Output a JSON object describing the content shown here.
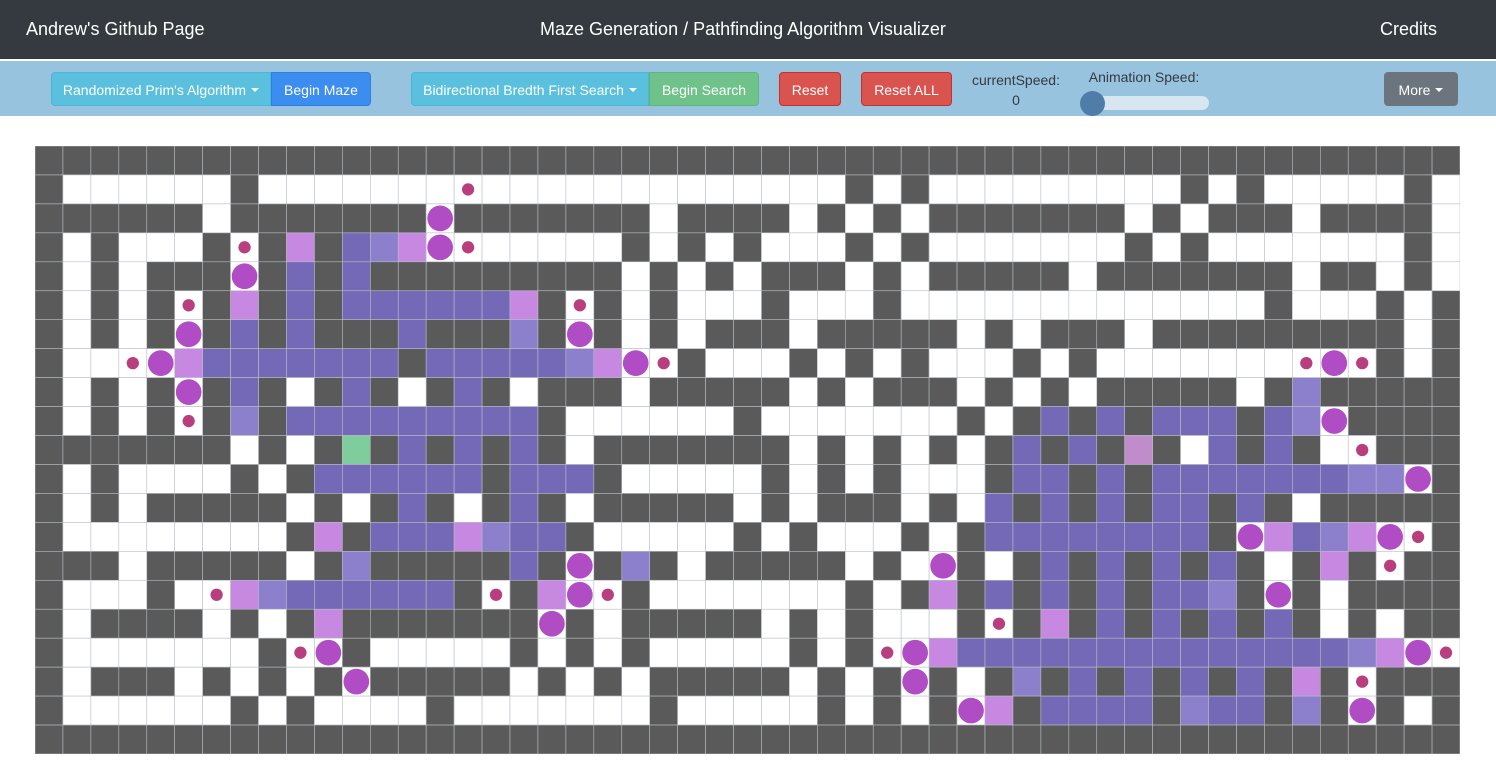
{
  "navbar": {
    "brand": "Andrew's Github Page",
    "title": "Maze Generation / Pathfinding Algorithm Visualizer",
    "credits": "Credits"
  },
  "controls": {
    "maze_algorithm": "Randomized Prim's Algorithm",
    "begin_maze": "Begin Maze",
    "search_algorithm": "Bidirectional Bredth First Search",
    "begin_search": "Begin Search",
    "reset": "Reset",
    "reset_all": "Reset ALL",
    "current_speed_label": "currentSpeed:",
    "current_speed_value": "0",
    "animation_speed_label": "Animation Speed:",
    "animation_speed_level": 0,
    "more": "More"
  },
  "colors": {
    "wall": "#5a5a5a",
    "open": "#ffffff",
    "start": "#7fcc9c",
    "end": "#c08ccc",
    "visited": "#7469b6",
    "frontier": "#c688e0",
    "node": "#b04cc4",
    "small_dot": "#b83e7e",
    "navbar": "#343a40",
    "control_bar": "#98c3de"
  },
  "maze": {
    "columns": 51,
    "rows": 21,
    "legend": "#=wall .=open S=start E=end v=visited l=light-visited f=frontier o=node-circle d=small-dot",
    "grid": [
      "###################################################",
      "#......#.......d.............#.#.........#.#.....#.#",
      "######.#######o#######.####.#.#.#######.#.###.####.#",
      "#.#...#d#f#vlfod.....#.#.#...#.#.......#.#.......#.#",
      "#.#.###o#v#v#########.#.#.###.#.#####.#######.##.#.#",
      "#.#.#d#f#v#vvvvvvf#d#.#...#...#.............#...#.#",
      "#.#.#o#v#v###v###l#o#.#.###.#####.#.###.#########.#",
      "#..dofvvvvvvv#vvvvvlfod#...#.#.#...#.#.......dod#.#",
      "#.#.#o#v#.#v#.#v#.###.#####.#.###.#.#.#####.#l###",
      "#.#.#d#l#vvvvvvvvv#......#.......#.#v#v#vvv#vlo#",
      "#######.#.#S#v#v#v#.#######.#.#.#.#v#v#E#.v#v#.d#",
      "#.#....#.#vvvvvv#vvv#.....#.#.#...#vv#v#vvvvvvvllo#",
      "#.#.#####.#.#v#.#v#.#####.#.###.#.v#v#v#vv#v#.#",
      "#........#f#vvvflvv#.....#.#...#.#vvvvvvvv#ofvlfod#",
      "###.#####.#l#####v#o#l#.#####.#.o#.#v#v#v#v#.#f#d#",
      "#...#.dflvvvvvv#d#fod#.......#.#f#v#v#v#vvl#o#.#",
      "#.####.#.#f#######o#.#####.#.#...#d#f#v#v#v#v#.#.#",
      "#.......#do#.....#.#.#.....#.#dofvvvvvvvvvvvvvvlfod#",
      "#.###.#.#.#o#####.#.#.#####.#.#o#.#l#v#v#v#v#f#d#",
      "#......#.#....#.......#.....#.#.#of#vvvv#lvv#l#o#.#",
      "###################################################"
    ]
  }
}
